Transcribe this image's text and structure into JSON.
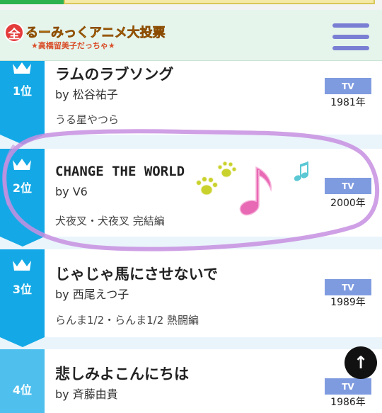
{
  "header": {
    "logo_badge": "全",
    "logo_title": "るーみっくアニメ大投票",
    "logo_subtitle": "★高橋留美子だっちゃ★",
    "menu_icon": "hamburger-icon"
  },
  "ranking": [
    {
      "rank_label": "1位",
      "title": "ラムのラブソング",
      "artist": "by 松谷祐子",
      "anime": "うる星やつら",
      "media": "TV",
      "year": "1981年"
    },
    {
      "rank_label": "2位",
      "title": "CHANGE THE WORLD",
      "artist": "by V6",
      "anime": "犬夜叉・犬夜叉 完結編",
      "media": "TV",
      "year": "2000年"
    },
    {
      "rank_label": "3位",
      "title": "じゃじゃ馬にさせないで",
      "artist": "by 西尾えつ子",
      "anime": "らんま1/2・らんま1/2 熱闘編",
      "media": "TV",
      "year": "1989年"
    },
    {
      "rank_label": "4位",
      "title": "悲しみよこんにちは",
      "artist": "by 斉藤由貴",
      "anime": "",
      "media": "TV",
      "year": "1986年"
    }
  ],
  "scroll_top": {
    "icon": "arrow-up-icon",
    "glyph": "↑"
  },
  "colors": {
    "rank_blue": "#14a9e6",
    "tv_badge": "#7f9be0",
    "menu": "#7a7fd4",
    "highlight_stroke": "#c78fe0",
    "paw": "#c9d22c",
    "music_note": "#e86ab5"
  }
}
